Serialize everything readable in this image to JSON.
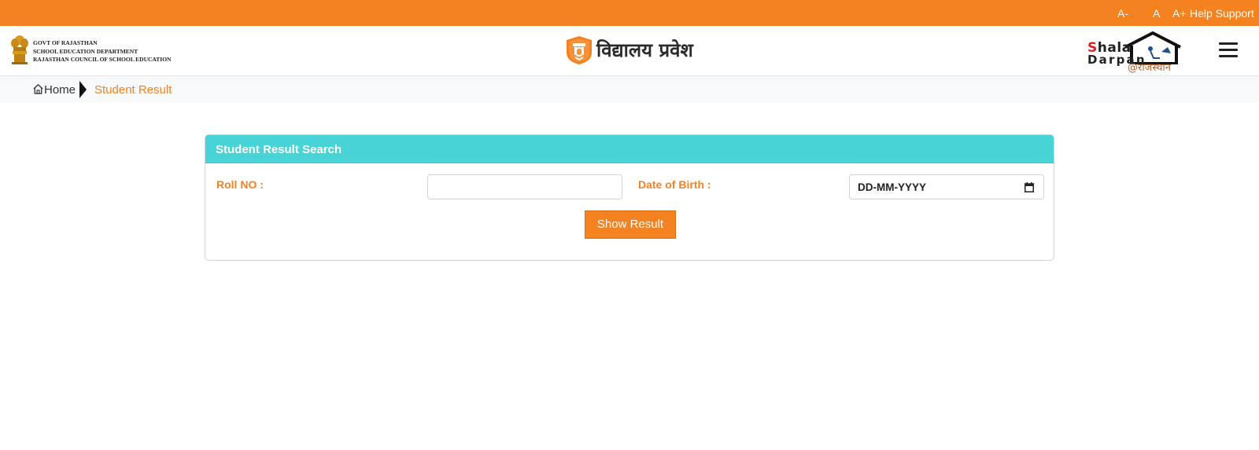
{
  "topbar": {
    "font_decrease": "A-",
    "font_normal": "A",
    "font_increase": "A+",
    "help_support": "Help Support",
    "color": "#f58220"
  },
  "header": {
    "govt_line1": "GOVT OF RAJASTHAN",
    "govt_line2": "SCHOOL EDUCATION DEPARTMENT",
    "govt_line3": "RAJASTHAN COUNCIL OF SCHOOL EDUCATION",
    "site_title": "विद्यालय प्रवेश",
    "shala_line1": "Shala",
    "shala_line2": "Darpan",
    "shala_line3": "@राजस्थान"
  },
  "breadcrumb": {
    "home": "Home",
    "current": "Student Result"
  },
  "search": {
    "title": "Student Result Search",
    "roll_label": "Roll NO :",
    "roll_value": "",
    "dob_label": "Date of Birth :",
    "dob_value": "DD-MM-YYYY",
    "submit_label": "Show Result",
    "header_color": "#48d3d6"
  },
  "icons": [
    "national-emblem-icon",
    "vidyalaya-pravesh-logo-icon",
    "shala-darpan-logo-icon",
    "hamburger-menu-icon",
    "home-icon",
    "chevron-right-icon",
    "calendar-icon"
  ]
}
